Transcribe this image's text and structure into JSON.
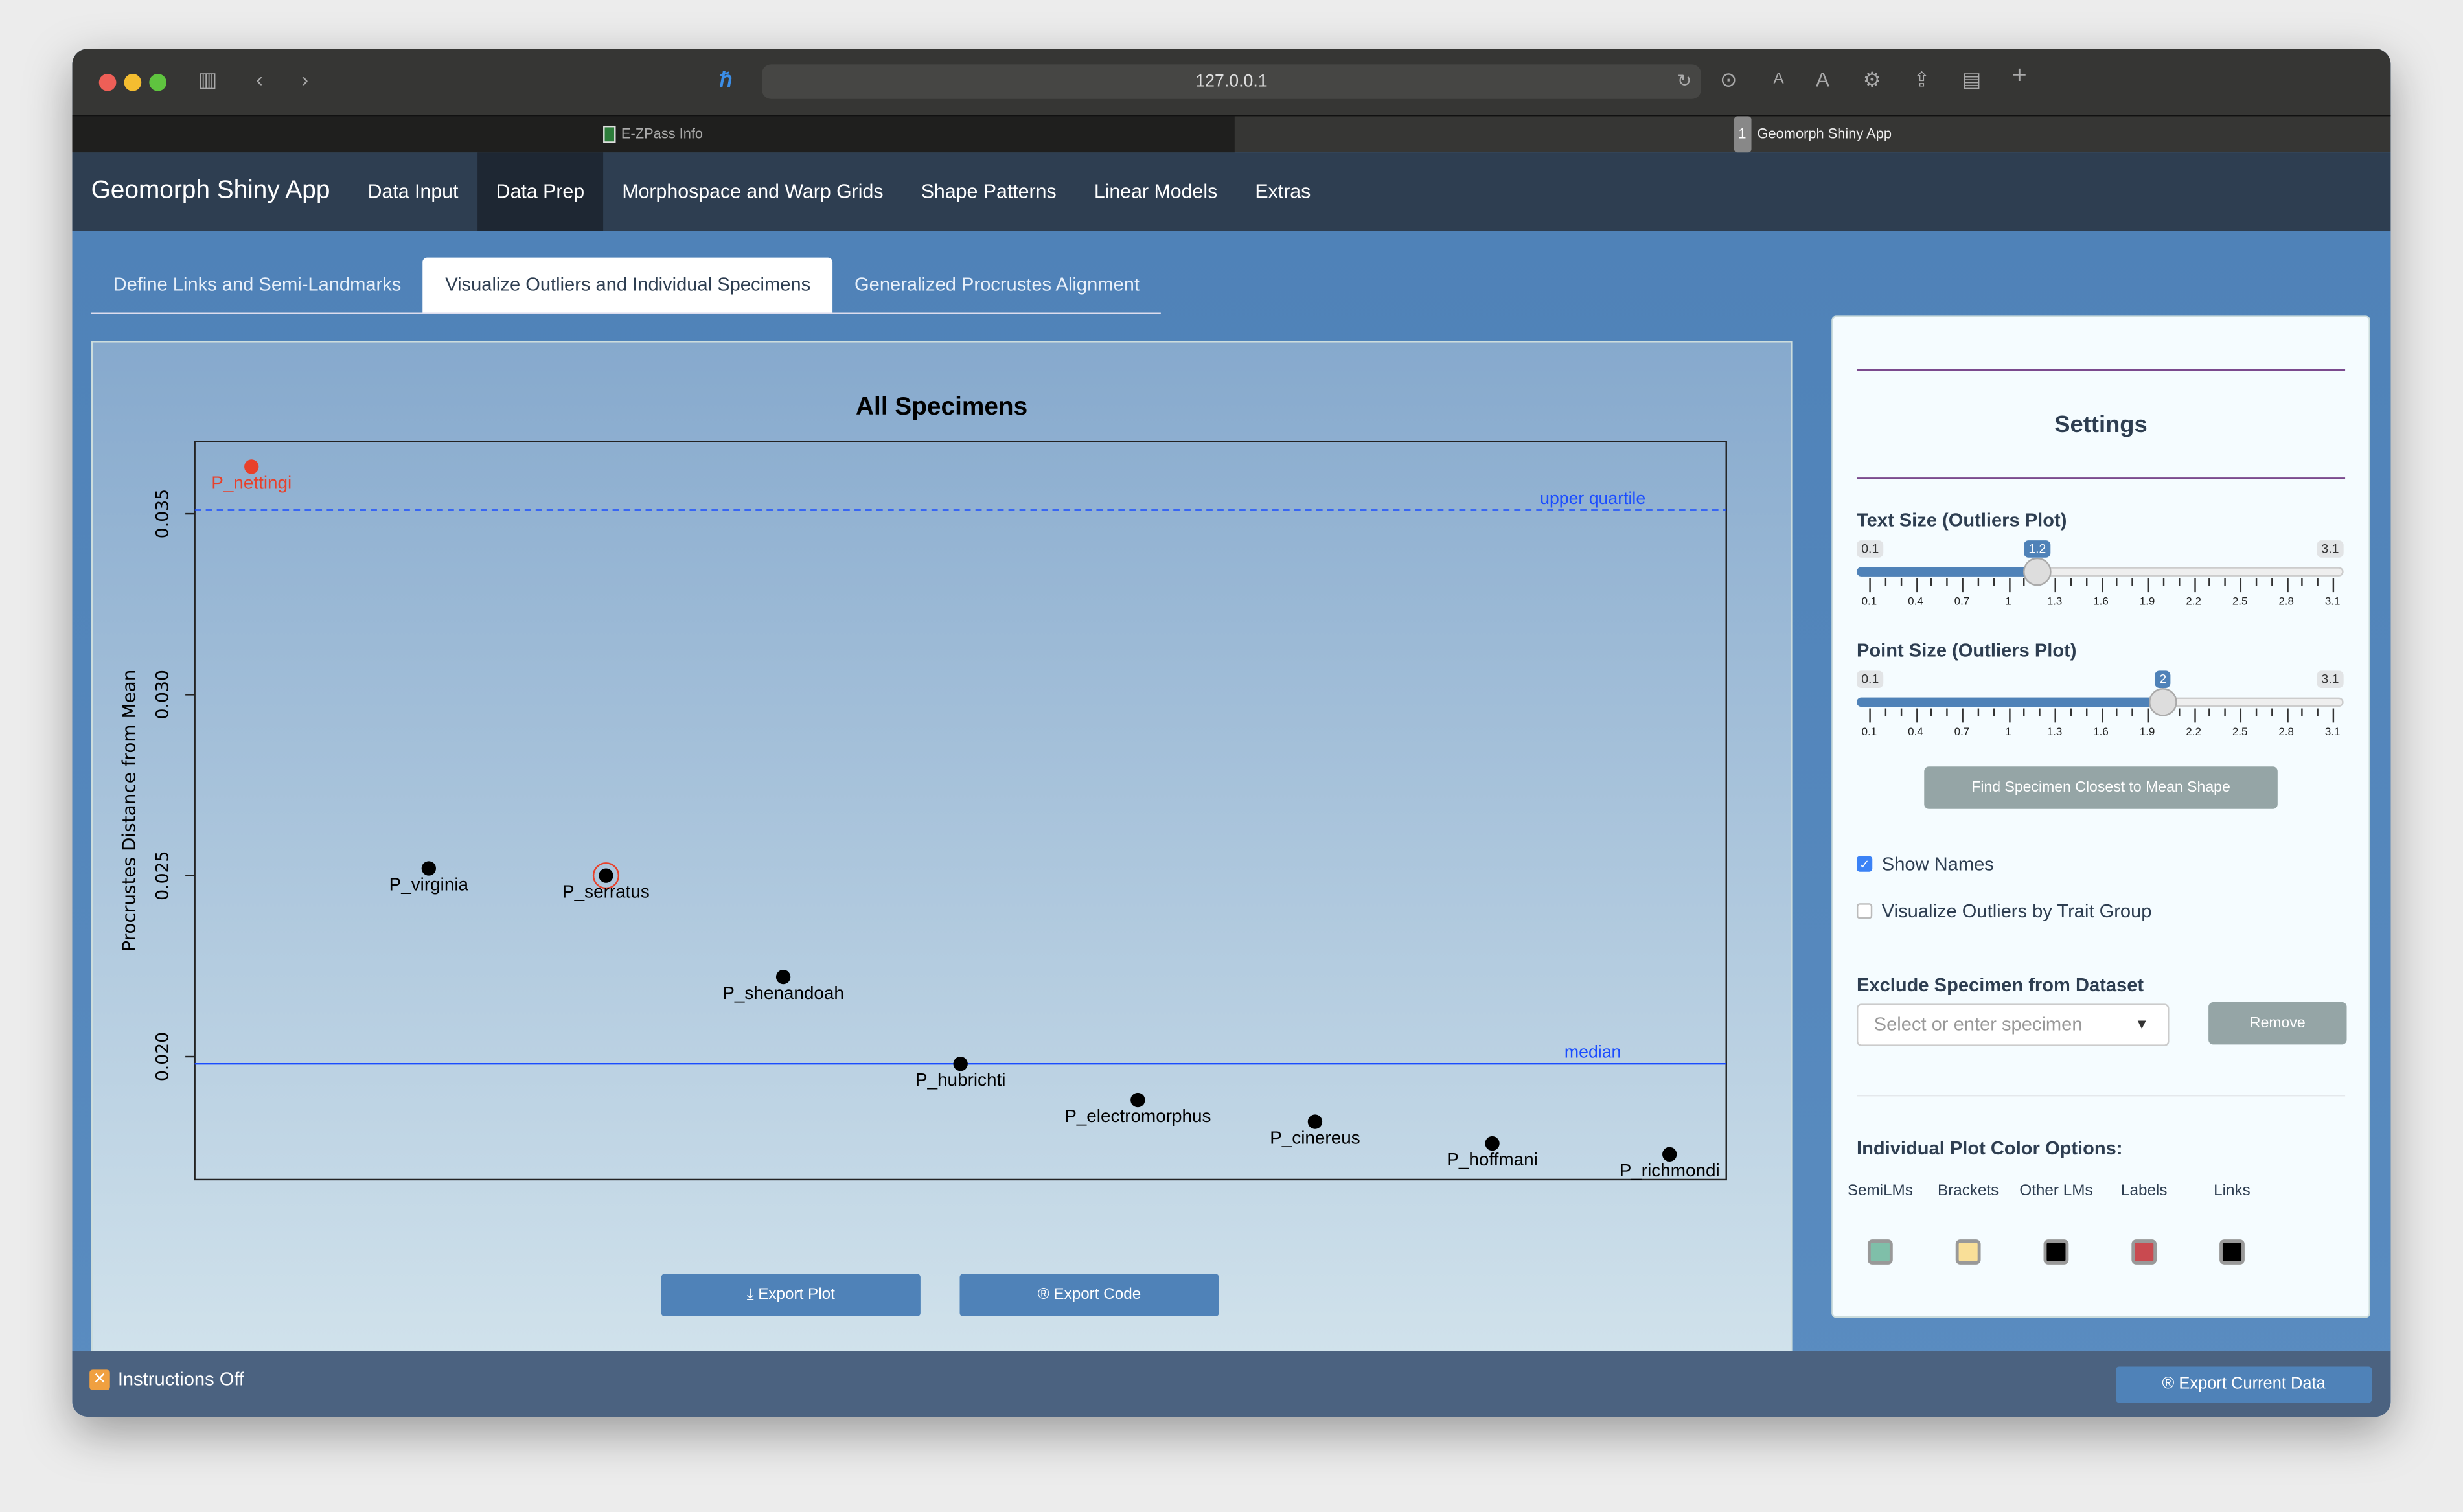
{
  "browser": {
    "url": "127.0.0.1",
    "tabs": [
      {
        "label": "E-ZPass Info"
      },
      {
        "badge": "1",
        "label": "Geomorph Shiny App"
      }
    ]
  },
  "nav": {
    "brand": "Geomorph Shiny App",
    "items": [
      "Data Input",
      "Data Prep",
      "Morphospace and Warp Grids",
      "Shape Patterns",
      "Linear Models",
      "Extras"
    ],
    "active": "Data Prep"
  },
  "subtabs": [
    "Define Links and Semi-Landmarks",
    "Visualize Outliers and Individual Specimens",
    "Generalized Procrustes Alignment"
  ],
  "plot_buttons": {
    "export_plot": "⤓ Export Plot",
    "export_code": "® Export Code"
  },
  "chart_data": {
    "type": "scatter",
    "title": "All Specimens",
    "xlabel": "",
    "ylabel": "Procrustes Distance from Mean",
    "ylim": [
      0.0166,
      0.037
    ],
    "xlim": [
      0.68,
      9.32
    ],
    "yticks": [
      "0.020",
      "0.025",
      "0.030",
      "0.035"
    ],
    "ytick_values": [
      0.02,
      0.025,
      0.03,
      0.035
    ],
    "points": [
      {
        "label": "P_nettingi",
        "x": 1,
        "y": 0.0363,
        "color": "#e8402a",
        "outlier": true
      },
      {
        "label": "P_virginia",
        "x": 2,
        "y": 0.0252,
        "color": "#000000"
      },
      {
        "label": "P_serratus",
        "x": 3,
        "y": 0.025,
        "color": "#000000",
        "highlighted": true
      },
      {
        "label": "P_shenandoah",
        "x": 4,
        "y": 0.0222,
        "color": "#000000"
      },
      {
        "label": "P_hubrichti",
        "x": 5,
        "y": 0.0198,
        "color": "#000000"
      },
      {
        "label": "P_electromorphus",
        "x": 6,
        "y": 0.0188,
        "color": "#000000"
      },
      {
        "label": "P_cinereus",
        "x": 7,
        "y": 0.0182,
        "color": "#000000"
      },
      {
        "label": "P_hoffmani",
        "x": 8,
        "y": 0.0176,
        "color": "#000000"
      },
      {
        "label": "P_richmondi",
        "x": 9,
        "y": 0.0173,
        "color": "#000000"
      }
    ],
    "lines": [
      {
        "label": "upper quartile",
        "y": 0.0351,
        "style": "dashed",
        "color": "#1a4cff"
      },
      {
        "label": "median",
        "y": 0.0198,
        "style": "solid",
        "color": "#1a4cff"
      }
    ]
  },
  "settings": {
    "title": "Settings",
    "text_size": {
      "label": "Text Size (Outliers Plot)",
      "min": "0.1",
      "max": "3.1",
      "value": "1.2",
      "fraction": 0.3667
    },
    "point_size": {
      "label": "Point Size (Outliers Plot)",
      "min": "0.1",
      "max": "3.1",
      "value": "2",
      "fraction": 0.6333
    },
    "tick_labels": [
      "0.1",
      "0.4",
      "0.7",
      "1",
      "1.3",
      "1.6",
      "1.9",
      "2.2",
      "2.5",
      "2.8",
      "3.1"
    ],
    "find_button": "Find Specimen Closest to Mean Shape",
    "show_names": "Show Names",
    "by_trait": "Visualize Outliers by Trait Group",
    "exclude_label": "Exclude Specimen from Dataset",
    "exclude_placeholder": "Select or enter specimen",
    "remove": "Remove",
    "color_title": "Individual Plot Color Options:",
    "colors": [
      {
        "label": "SemiLMs",
        "color": "#7fbfa9"
      },
      {
        "label": "Brackets",
        "color": "#f9df98"
      },
      {
        "label": "Other LMs",
        "color": "#000000"
      },
      {
        "label": "Labels",
        "color": "#c94a50"
      },
      {
        "label": "Links",
        "color": "#000000"
      }
    ]
  },
  "footer": {
    "instructions": "Instructions Off",
    "export_data": "® Export Current Data"
  }
}
